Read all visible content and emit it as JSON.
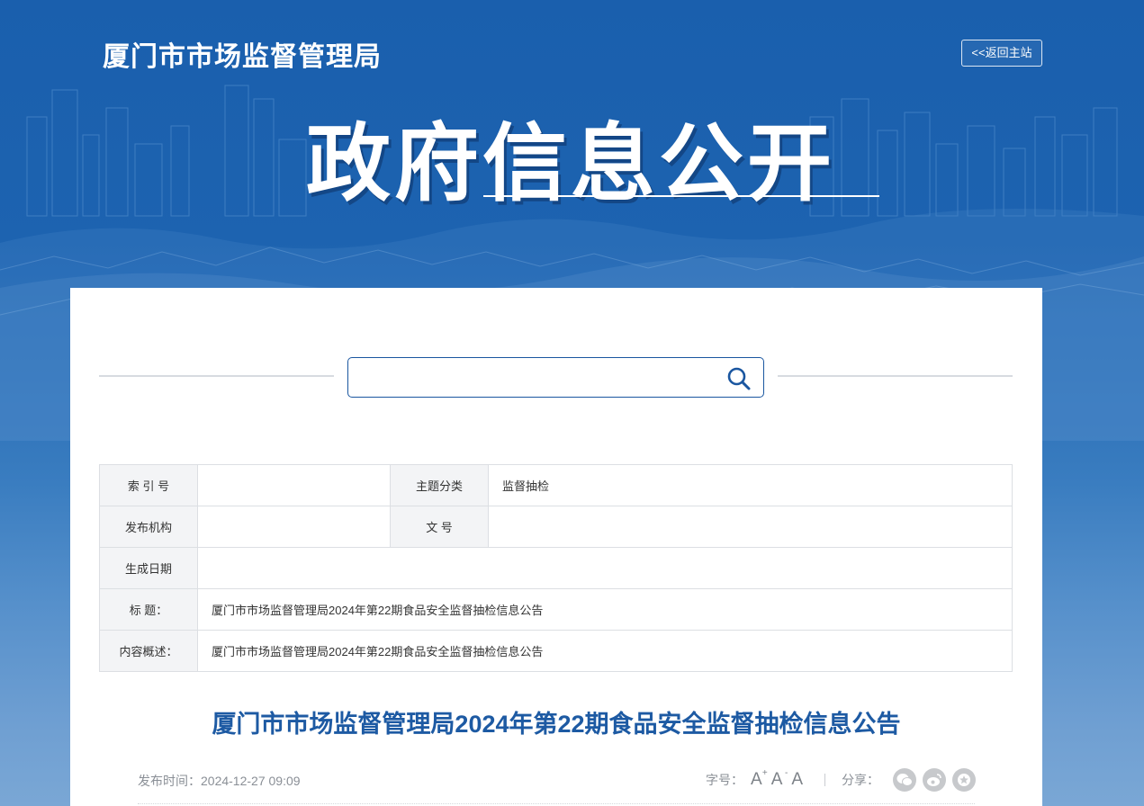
{
  "header": {
    "site_name": "厦门市市场监督管理局",
    "home_link": "<<返回主站",
    "hero_title": "政府信息公开"
  },
  "search": {
    "value": "",
    "placeholder": ""
  },
  "meta_table": {
    "index_label": "索 引 号",
    "index_value": "",
    "topic_label": "主题分类",
    "topic_value": "监督抽检",
    "publisher_label": "发布机构",
    "publisher_value": "",
    "docno_label": "文 号",
    "docno_value": "",
    "date_label": "生成日期",
    "date_value": "",
    "title_label": "标 题：",
    "title_value": "厦门市市场监督管理局2024年第22期食品安全监督抽检信息公告",
    "summary_label": "内容概述：",
    "summary_value": "厦门市市场监督管理局2024年第22期食品安全监督抽检信息公告"
  },
  "article": {
    "title": "厦门市市场监督管理局2024年第22期食品安全监督抽检信息公告",
    "publish_time": "发布时间：2024-12-27 09:09",
    "font_size_label": "字号：",
    "font_large": "A",
    "font_large_sup": "+",
    "font_small": "A",
    "font_small_sup": "-",
    "font_default": "A",
    "share_label": "分享："
  },
  "icons": {
    "search": "search-icon",
    "wechat": "wechat-icon",
    "weibo": "weibo-icon",
    "favorite": "star-icon"
  },
  "colors": {
    "brand_blue": "#1a56a0",
    "title_blue": "#1d5aa3"
  }
}
